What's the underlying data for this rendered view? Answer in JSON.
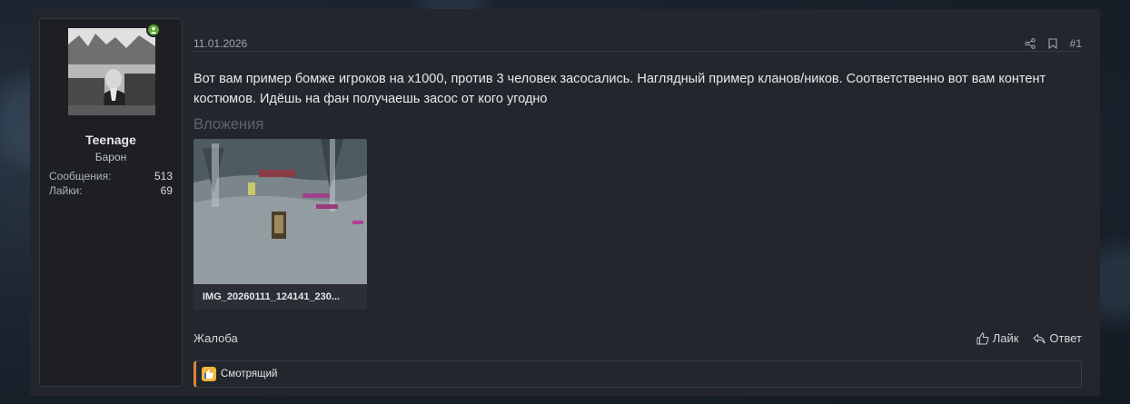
{
  "post": {
    "date": "11.01.2026",
    "number": "#1",
    "message": "Вот вам пример бомже игроков на х1000, против 3 человек засосались. Наглядный пример кланов/ников. Соответственно вот вам контент костюмов. Идёшь на фан получаешь засос от кого угодно",
    "attachments_title": "Вложения",
    "attachment_name": "IMG_20260111_124141_230...",
    "report_label": "Жалоба",
    "like_label": "Лайк",
    "reply_label": "Ответ",
    "reaction_user": "Смотрящий"
  },
  "user": {
    "name": "Teenage",
    "title": "Барон",
    "stats": [
      {
        "label": "Сообщения:",
        "value": "513"
      },
      {
        "label": "Лайки:",
        "value": "69"
      }
    ],
    "online_color": "#5aa532"
  },
  "icons": {
    "share": "share-icon",
    "bookmark": "bookmark-icon",
    "like": "thumbs-up-icon",
    "reply": "reply-icon"
  },
  "colors": {
    "reaction_accent": "#d9823a",
    "background": "#24262d"
  }
}
